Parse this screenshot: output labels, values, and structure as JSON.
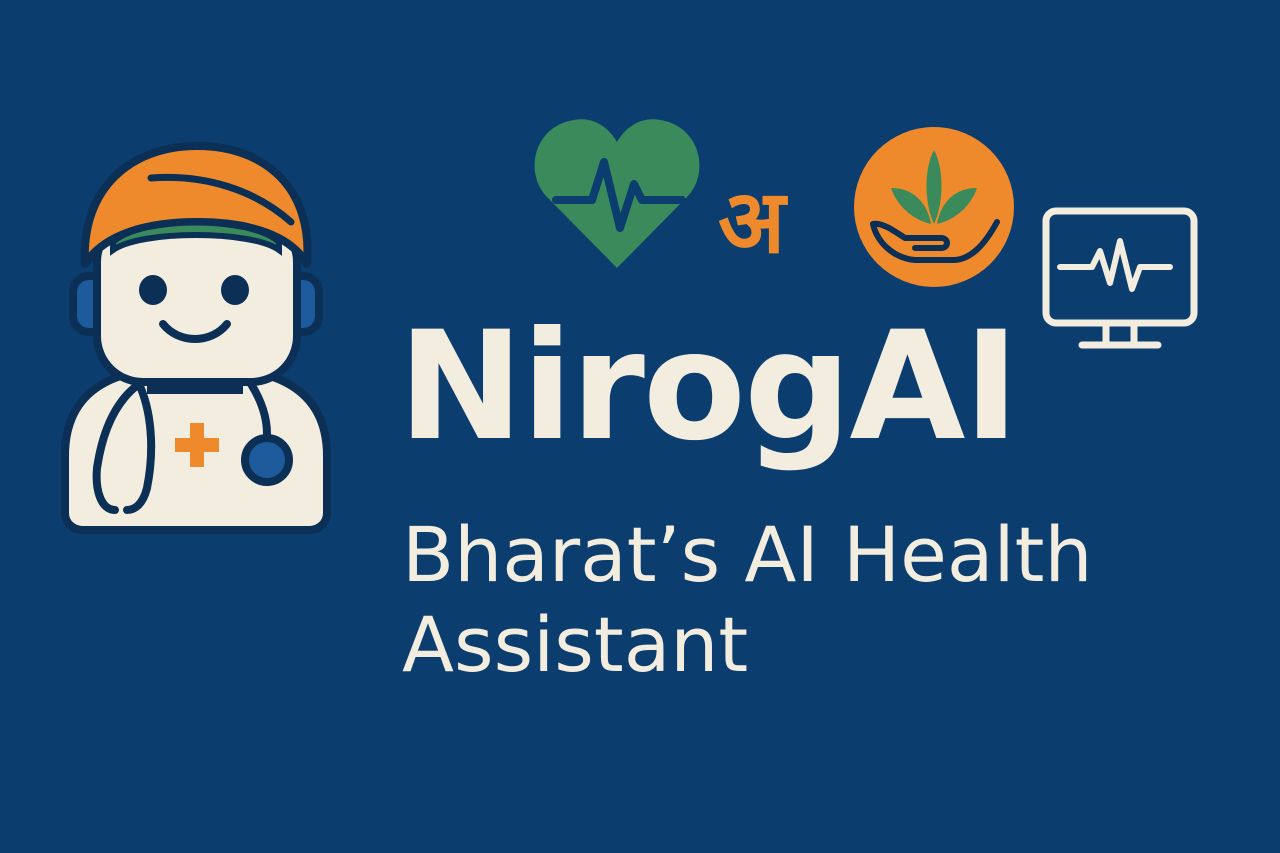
{
  "brand": {
    "title": "NirogAI",
    "tagline": "Bharat’s AI Health Assistant"
  },
  "icons": {
    "mascot": "doctor-robot-icon",
    "heart": "heart-pulse-icon",
    "language": "devanagari-letter-icon",
    "care": "hand-plant-icon",
    "monitor": "heart-monitor-icon",
    "language_glyph": "अ"
  },
  "colors": {
    "background": "#0b3d6f",
    "cream": "#f3ede0",
    "saffron": "#ef8a2c",
    "green": "#3a8a5c",
    "navy": "#0b3d6f",
    "blue_accent": "#1d5b9c"
  }
}
